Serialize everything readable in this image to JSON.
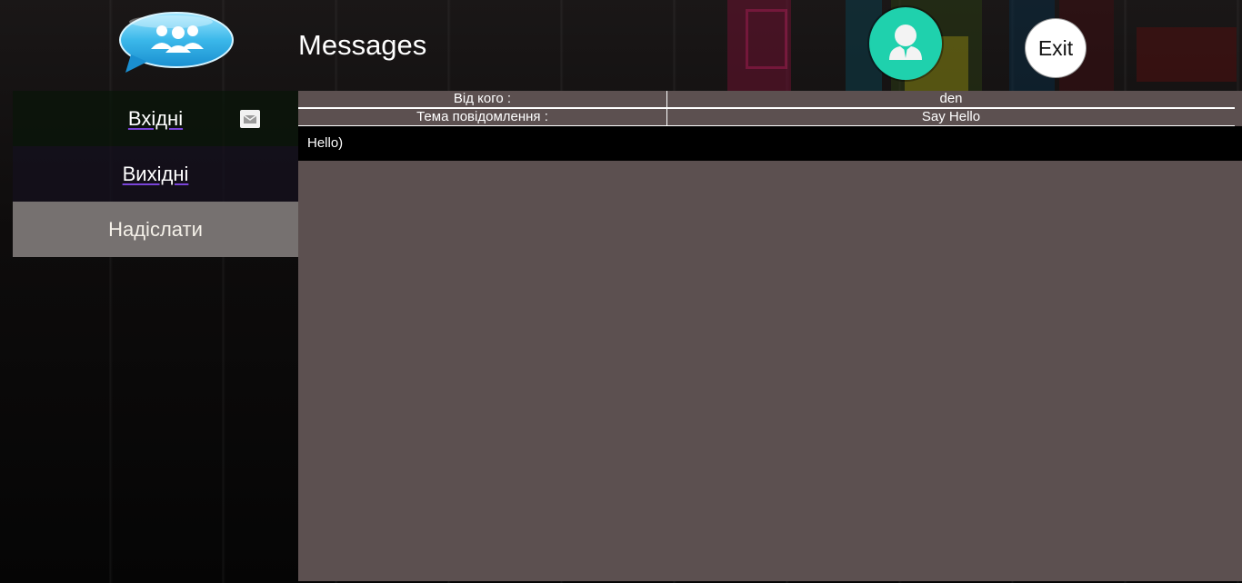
{
  "header": {
    "title": "Messages",
    "exit_label": "Exit",
    "logo_icon": "chat-bubble-users-icon",
    "avatar_icon": "user-avatar-icon"
  },
  "sidebar": {
    "items": [
      {
        "label": "Вхідні",
        "icon": "mail-icon",
        "active": false
      },
      {
        "label": "Вихідні",
        "active": false
      },
      {
        "label": "Надіслати",
        "active": true
      }
    ]
  },
  "message": {
    "from_label": "Від кого :",
    "from_value": "den",
    "subject_label": "Тема повідомлення :",
    "subject_value": "Say Hello",
    "body": "Hello)"
  },
  "colors": {
    "content_bg": "#5c5050",
    "avatar": "#1fd1ad",
    "active_nav": "#767170",
    "nav_underline": "#7a44d8"
  }
}
